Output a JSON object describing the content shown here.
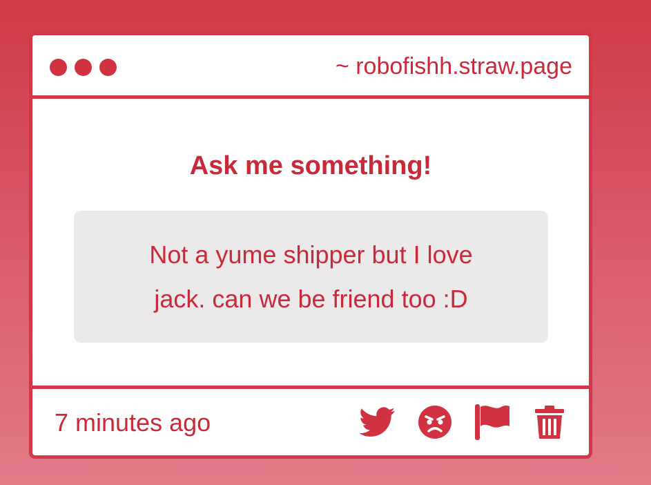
{
  "window": {
    "url": "~ robofishh.straw.page"
  },
  "main": {
    "title": "Ask me something!",
    "question_line_1": "Not a yume shipper but I love",
    "question_line_2": "jack. can we be friend too :D"
  },
  "footer": {
    "time": "7 minutes ago",
    "actions": [
      {
        "icon": "twitter-icon"
      },
      {
        "icon": "angry-face-icon"
      },
      {
        "icon": "flag-icon"
      },
      {
        "icon": "trash-icon"
      }
    ]
  },
  "colors": {
    "accent": "#d43846",
    "text": "#c92a3a",
    "question_bg": "#ebe9ea",
    "background_top": "#d13947",
    "background_bottom": "#e27a88"
  }
}
